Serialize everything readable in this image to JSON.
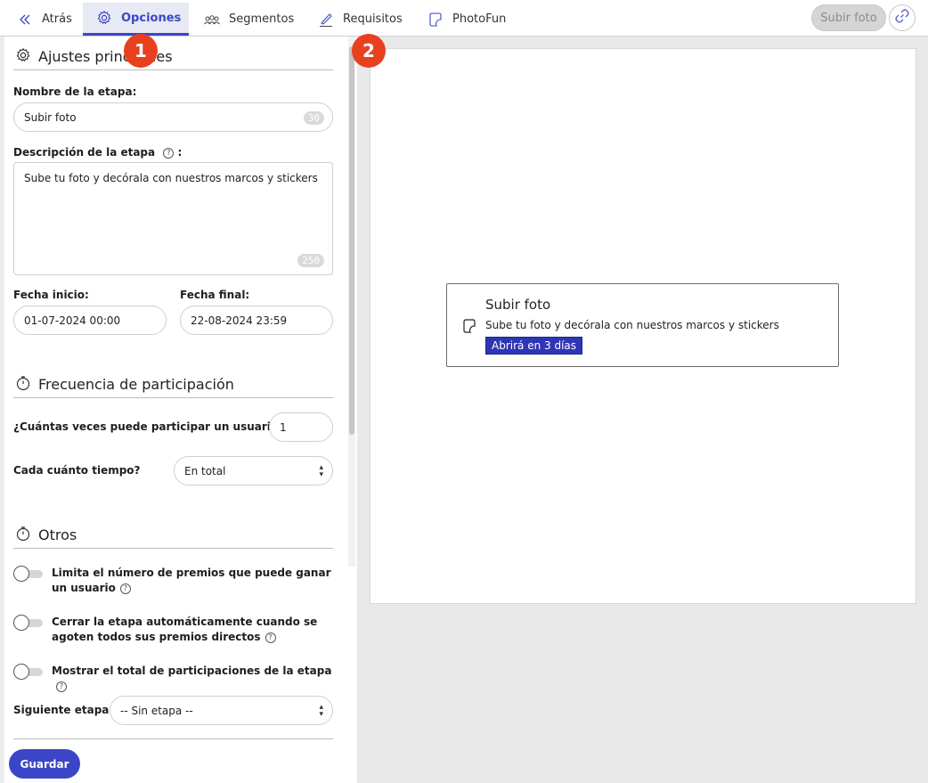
{
  "nav": {
    "back_label": "Atrás",
    "tabs": [
      {
        "label": "Opciones"
      },
      {
        "label": "Segmentos"
      },
      {
        "label": "Requisitos"
      },
      {
        "label": "PhotoFun"
      }
    ],
    "subir_label": "Subir foto"
  },
  "ajustes": {
    "title": "Ajustes principales",
    "nombre_label": "Nombre de la etapa:",
    "nombre_value": "Subir foto",
    "nombre_counter": "30",
    "descripcion_label": "Descripción de la etapa",
    "descripcion_suffix": ":",
    "descripcion_value": "Sube tu foto y decórala con nuestros marcos y stickers",
    "descripcion_counter": "250",
    "fecha_inicio_label": "Fecha inicio:",
    "fecha_inicio_value": "01-07-2024 00:00",
    "fecha_final_label": "Fecha final:",
    "fecha_final_value": "22-08-2024 23:59"
  },
  "frecuencia": {
    "title": "Frecuencia de participación",
    "veces_label": "¿Cuántas veces puede participar un usuario?",
    "veces_value": "1",
    "cada_label": "Cada cuánto tiempo?",
    "cada_value": "En total"
  },
  "otros": {
    "title": "Otros",
    "toggle1": "Limita el número de premios que puede ganar un usuario",
    "toggle2": "Cerrar la etapa automáticamente cuando se agoten todos sus premios directos",
    "toggle3": "Mostrar el total de participaciones de la etapa",
    "siguiente_label": "Siguiente etapa:",
    "siguiente_value": "-- Sin etapa --"
  },
  "guardar_label": "Guardar",
  "preview": {
    "title": "Subir foto",
    "description": "Sube tu foto y decórala con nuestros marcos y stickers",
    "badge": "Abrirá en 3 días"
  },
  "steps": [
    "1",
    "2"
  ],
  "colors": {
    "accent": "#3b46c6",
    "step": "#e8401f",
    "badge": "#2f36b5"
  }
}
